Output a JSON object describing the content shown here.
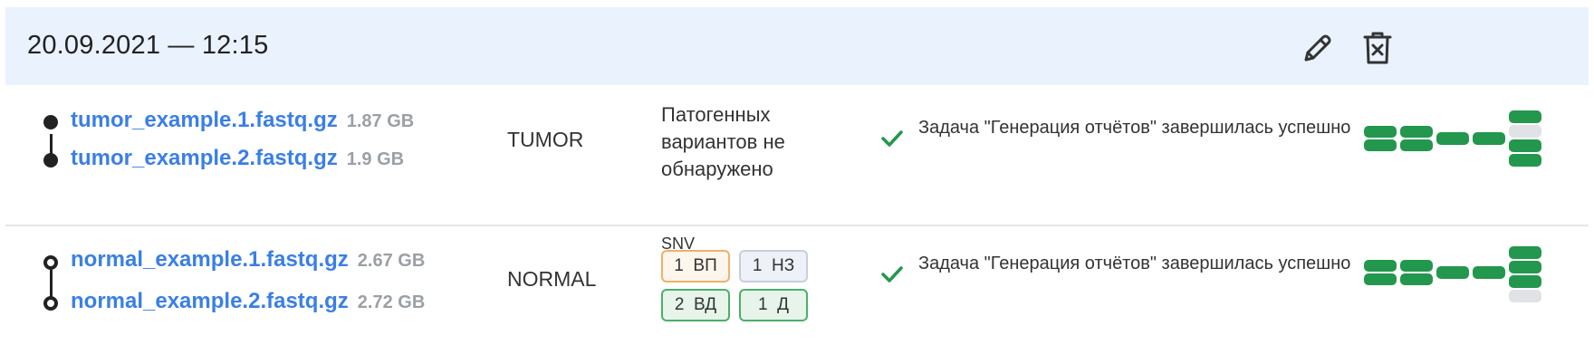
{
  "header": {
    "title": "20.09.2021 — 12:15",
    "edit_icon": "pencil-icon",
    "delete_icon": "trash-icon"
  },
  "colors": {
    "link": "#3a7fe6",
    "success": "#23974d",
    "header_bg": "#eaf2fd",
    "pending": "#e0e2e6"
  },
  "rows": [
    {
      "files": [
        {
          "name": "tumor_example.1.fastq.gz",
          "size": "1.87 GB"
        },
        {
          "name": "tumor_example.2.fastq.gz",
          "size": "1.9 GB"
        }
      ],
      "sample_type": "TUMOR",
      "variants_text": "Патогенных вариантов не обнаружено",
      "status_icon": "checkmark-icon",
      "status_text": "Задача \"Генерация отчётов\" завершилась успешно",
      "pipeline_last_column": [
        "done",
        "pending",
        "done",
        "done"
      ]
    },
    {
      "files": [
        {
          "name": "normal_example.1.fastq.gz",
          "size": "2.67 GB"
        },
        {
          "name": "normal_example.2.fastq.gz",
          "size": "2.72 GB"
        }
      ],
      "sample_type": "NORMAL",
      "snv_label": "SNV",
      "badges": [
        {
          "count": "1",
          "label": "ВП"
        },
        {
          "count": "1",
          "label": "НЗ"
        },
        {
          "count": "2",
          "label": "ВД"
        },
        {
          "count": "1",
          "label": "Д"
        }
      ],
      "status_icon": "checkmark-icon",
      "status_text": "Задача \"Генерация отчётов\" завершилась успешно",
      "pipeline_last_column": [
        "done",
        "done",
        "done",
        "pending"
      ]
    }
  ]
}
